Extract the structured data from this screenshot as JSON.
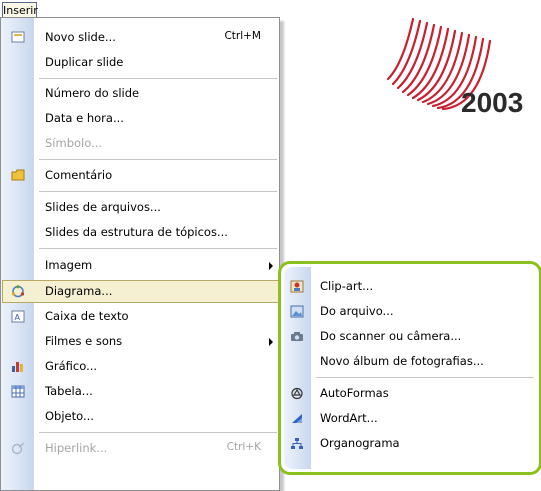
{
  "menubar": {
    "inserir_label": "Inserir"
  },
  "menu": {
    "items": [
      {
        "label": "Novo slide...",
        "shortcut": "Ctrl+M"
      },
      {
        "label": "Duplicar slide"
      },
      {
        "label": "Número do slide"
      },
      {
        "label": "Data e hora..."
      },
      {
        "label": "Símbolo..."
      },
      {
        "label": "Comentário"
      },
      {
        "label": "Slides de arquivos..."
      },
      {
        "label": "Slides da estrutura de tópicos..."
      },
      {
        "label": "Imagem"
      },
      {
        "label": "Diagrama..."
      },
      {
        "label": "Caixa de texto"
      },
      {
        "label": "Filmes e sons"
      },
      {
        "label": "Gráfico..."
      },
      {
        "label": "Tabela..."
      },
      {
        "label": "Objeto..."
      },
      {
        "label": "Hiperlink...",
        "shortcut": "Ctrl+K"
      }
    ]
  },
  "submenu": {
    "items": [
      {
        "label": "Clip-art..."
      },
      {
        "label": "Do arquivo..."
      },
      {
        "label": "Do scanner ou câmera..."
      },
      {
        "label": "Novo álbum de fotografias..."
      },
      {
        "label": "AutoFormas"
      },
      {
        "label": "WordArt..."
      },
      {
        "label": "Organograma"
      }
    ]
  },
  "logo": {
    "text": "2003"
  },
  "colors": {
    "highlight_border": "#8ac11f",
    "logo_red": "#c8202f",
    "logo_text": "#2b2b2b"
  }
}
